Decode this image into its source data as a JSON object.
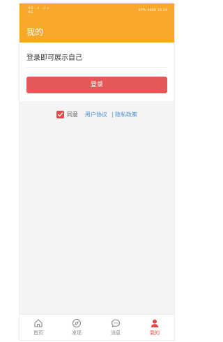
{
  "status_bar": {
    "left_line1": "4G ..ıl ..ıl ⁎",
    "left_line2": "4G",
    "right": "97% 4600 18:24"
  },
  "header": {
    "title": "我的"
  },
  "login": {
    "prompt": "登录即可展示自己",
    "button_label": "登录"
  },
  "agreement": {
    "checked": true,
    "agree_label": "同意",
    "user_agreement": "用户协议",
    "separator": "|",
    "privacy_policy": "隐私政策"
  },
  "tabbar": {
    "items": [
      {
        "label": "首页",
        "icon": "home-icon",
        "active": false
      },
      {
        "label": "发现",
        "icon": "compass-icon",
        "active": false
      },
      {
        "label": "消息",
        "icon": "message-icon",
        "active": false
      },
      {
        "label": "我的",
        "icon": "user-icon",
        "active": true
      }
    ]
  },
  "colors": {
    "header": "#f8a92a",
    "button": "#e65757",
    "link": "#4a90d9",
    "active_tab": "#e54848"
  }
}
